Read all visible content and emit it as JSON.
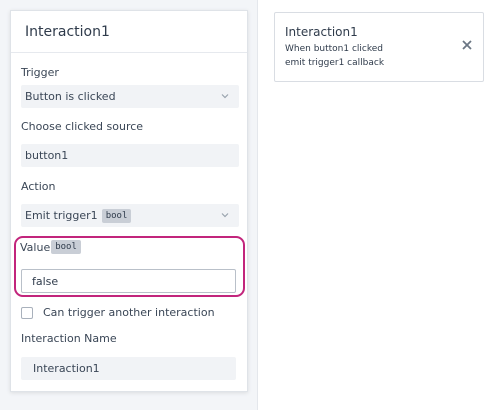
{
  "panel": {
    "title": "Interaction1",
    "trigger": {
      "label": "Trigger",
      "value": "Button is clicked"
    },
    "source": {
      "label": "Choose clicked source",
      "value": "button1"
    },
    "action": {
      "label": "Action",
      "value": "Emit trigger1",
      "badge": "bool"
    },
    "value_field": {
      "label": "Value",
      "badge": "bool",
      "value": "false"
    },
    "checkbox": {
      "label": "Can trigger another interaction",
      "checked": false
    },
    "name_field": {
      "label": "Interaction Name",
      "value": "Interaction1"
    }
  },
  "card": {
    "title": "Interaction1",
    "line1": "When button1 clicked",
    "line2": "emit trigger1 callback"
  },
  "icons": {
    "chevron": "chevron-down-icon",
    "close": "close-icon"
  },
  "colors": {
    "highlight": "#c2257c",
    "badge_bg": "#c9ced6",
    "select_bg": "#f1f3f6"
  }
}
